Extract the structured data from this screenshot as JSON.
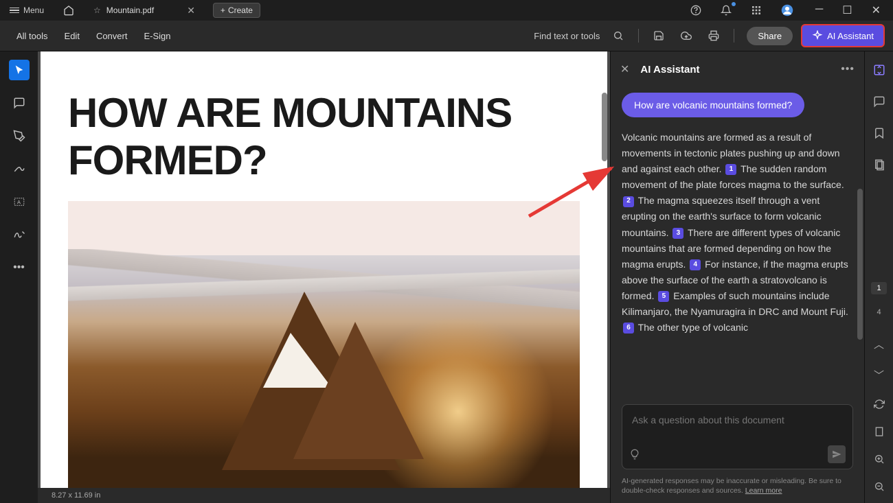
{
  "titlebar": {
    "menu_label": "Menu",
    "tab_name": "Mountain.pdf",
    "create_label": "Create"
  },
  "toolbar": {
    "items": [
      "All tools",
      "Edit",
      "Convert",
      "E-Sign"
    ],
    "find_label": "Find text or tools",
    "share_label": "Share",
    "ai_label": "AI Assistant"
  },
  "document": {
    "title": "HOW ARE MOUNTAINS FORMED?",
    "page_dimensions": "8.27 x 11.69 in"
  },
  "ai_panel": {
    "header": "AI Assistant",
    "question": "How are volcanic mountains formed?",
    "answer_parts": [
      "Volcanic mountains are formed as a result of movements in tectonic plates pushing up and down and against each other.",
      "The sudden random movement of the plate forces magma to the surface.",
      "The magma squeezes itself through a vent erupting on the earth's surface to form volcanic mountains.",
      "There are different types of volcanic mountains that are formed depending on how the magma erupts.",
      "For instance, if the magma erupts above the surface of the earth a stratovolcano is formed.",
      "Examples of such mountains include Kilimanjaro, the Nyamuragira in DRC and Mount Fuji.",
      "The other type of volcanic"
    ],
    "citations": [
      "1",
      "2",
      "3",
      "4",
      "5",
      "6"
    ],
    "input_placeholder": "Ask a question about this document",
    "disclaimer": "AI-generated responses may be inaccurate or misleading. Be sure to double-check responses and sources.",
    "learn_more": "Learn more"
  },
  "pages": {
    "current": "1",
    "total": "4"
  }
}
